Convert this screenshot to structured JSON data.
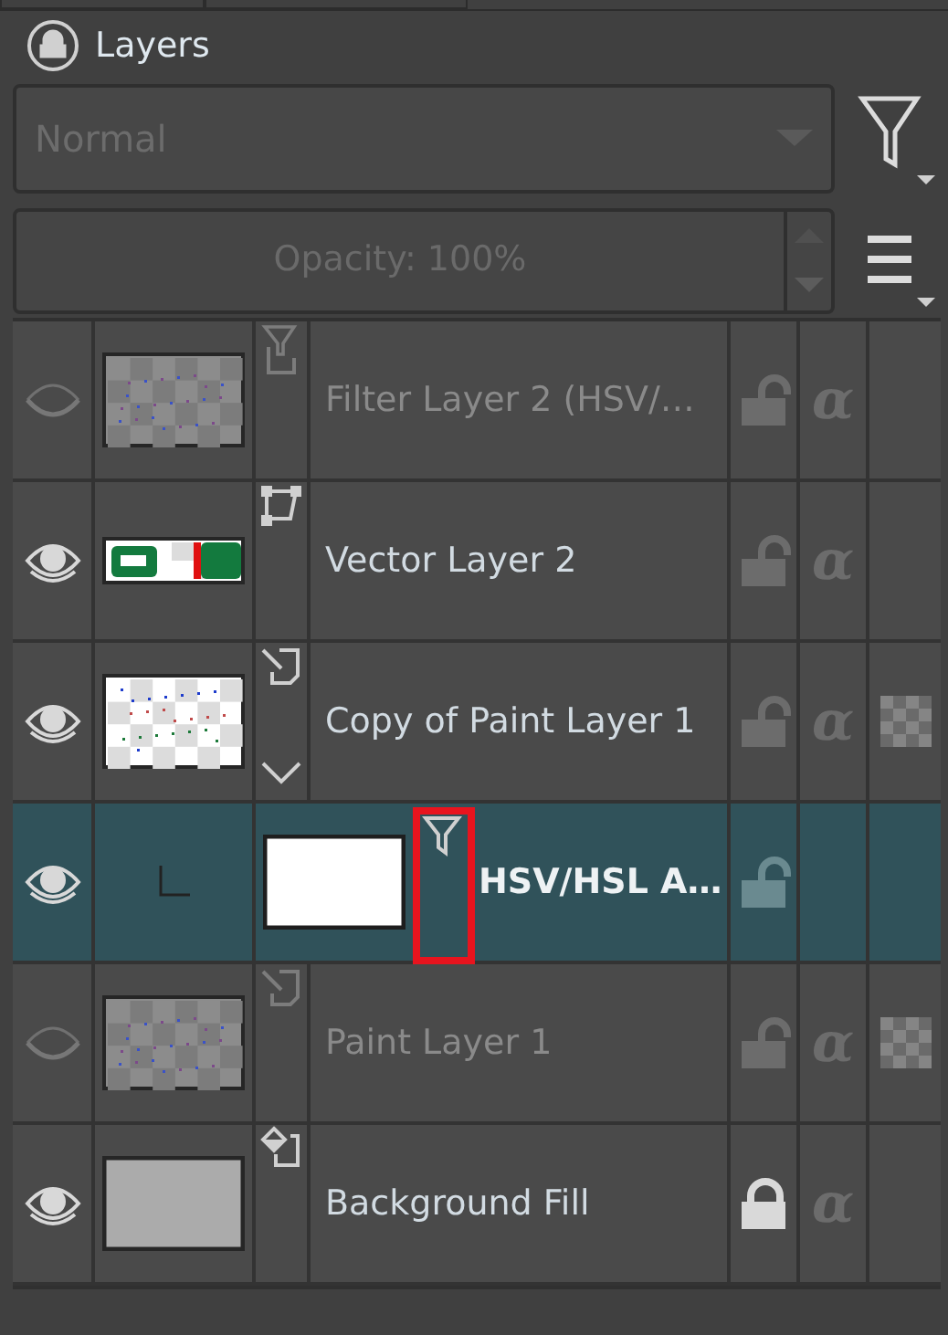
{
  "panel": {
    "title": "Layers"
  },
  "blend_mode": {
    "value": "Normal",
    "disabled": true
  },
  "opacity": {
    "value": "Opacity:  100%",
    "disabled": true
  },
  "layers": [
    {
      "name": "Filter Layer 2 (HSV/…",
      "kind": "filter",
      "visible": false,
      "selected": false,
      "locked": false,
      "alpha": "α",
      "inherit_alpha": false
    },
    {
      "name": "Vector Layer 2",
      "kind": "vector",
      "visible": true,
      "selected": false,
      "locked": false,
      "alpha": "α",
      "inherit_alpha": false
    },
    {
      "name": "Copy of Paint Layer 1",
      "kind": "paint",
      "visible": true,
      "selected": false,
      "locked": false,
      "alpha": "α",
      "inherit_alpha": true,
      "expanded": true,
      "children": [
        {
          "name": "HSV/HSL A…",
          "kind": "filter-mask",
          "visible": true,
          "selected": true,
          "locked": false,
          "inherit_alpha": false,
          "highlighted": true
        }
      ]
    },
    {
      "name": "Paint Layer 1",
      "kind": "paint",
      "visible": false,
      "selected": false,
      "locked": false,
      "alpha": "α",
      "inherit_alpha": true
    },
    {
      "name": "Background Fill",
      "kind": "fill",
      "visible": true,
      "selected": false,
      "locked": true,
      "alpha": "α",
      "inherit_alpha": false
    }
  ]
}
